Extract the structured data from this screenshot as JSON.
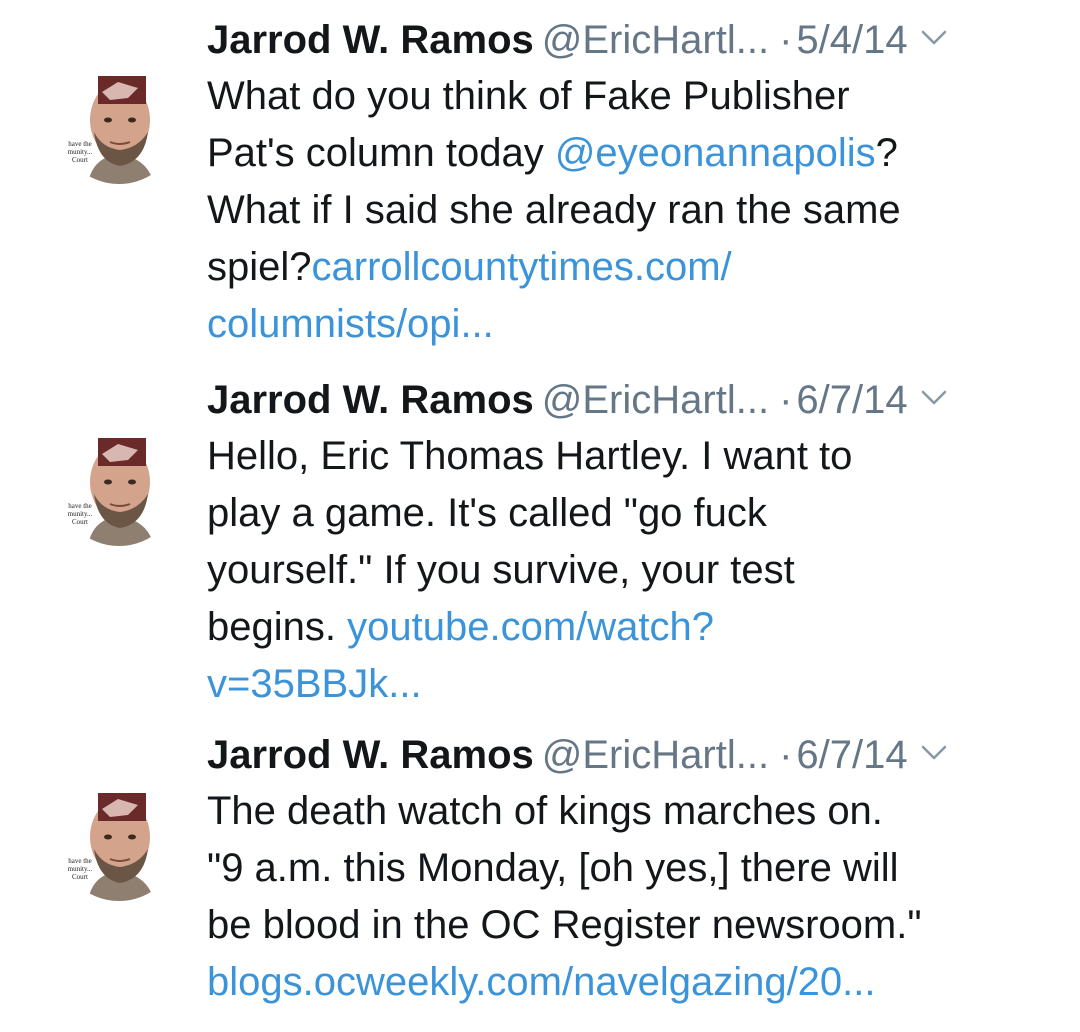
{
  "colors": {
    "text": "#14171a",
    "secondary": "#657786",
    "link": "#3b94d9",
    "background": "#ffffff"
  },
  "icons": {
    "avatar": "profile-photo",
    "menu": "chevron-down-icon"
  },
  "tweets": [
    {
      "author_name": "Jarrod W. Ramos",
      "handle": "@EricHartl...",
      "separator": "·",
      "date": "5/4/14",
      "avatar_caption": [
        "have the",
        "munity...",
        "Court"
      ],
      "lines": [
        {
          "a": "What do you think of Fake Publisher",
          "b": "",
          "c": ""
        },
        {
          "a": "Pat's column today ",
          "b": "@eyeonannapolis",
          "c": "?"
        },
        {
          "a": "What if I said she already ran the same",
          "b": "",
          "c": ""
        },
        {
          "a": "spiel?",
          "b": "carrollcountytimes.com/",
          "c": ""
        },
        {
          "a": "",
          "b": "columnists/opi...",
          "c": ""
        }
      ]
    },
    {
      "author_name": "Jarrod W. Ramos",
      "handle": "@EricHartl...",
      "separator": "·",
      "date": "6/7/14",
      "avatar_caption": [
        "have the",
        "munity...",
        "Court"
      ],
      "lines": [
        {
          "a": "Hello, Eric Thomas Hartley. I want to",
          "b": "",
          "c": ""
        },
        {
          "a": "play a game. It's called \"go fuck",
          "b": "",
          "c": ""
        },
        {
          "a": "yourself.\" If you survive, your test",
          "b": "",
          "c": ""
        },
        {
          "a": "begins. ",
          "b": "youtube.com/watch?",
          "c": ""
        },
        {
          "a": "",
          "b": "v=35BBJk...",
          "c": ""
        }
      ]
    },
    {
      "author_name": "Jarrod W. Ramos",
      "handle": "@EricHartl...",
      "separator": "·",
      "date": "6/7/14",
      "avatar_caption": [
        "have the",
        "munity...",
        "Court"
      ],
      "lines": [
        {
          "a": "The death watch of kings marches on.",
          "b": "",
          "c": ""
        },
        {
          "a": "\"9 a.m. this Monday, [oh yes,] there will",
          "b": "",
          "c": ""
        },
        {
          "a": "be blood in the OC Register newsroom.\"",
          "b": "",
          "c": ""
        },
        {
          "a": "",
          "b": "blogs.ocweekly.com/navelgazing/20...",
          "c": ""
        }
      ]
    }
  ]
}
